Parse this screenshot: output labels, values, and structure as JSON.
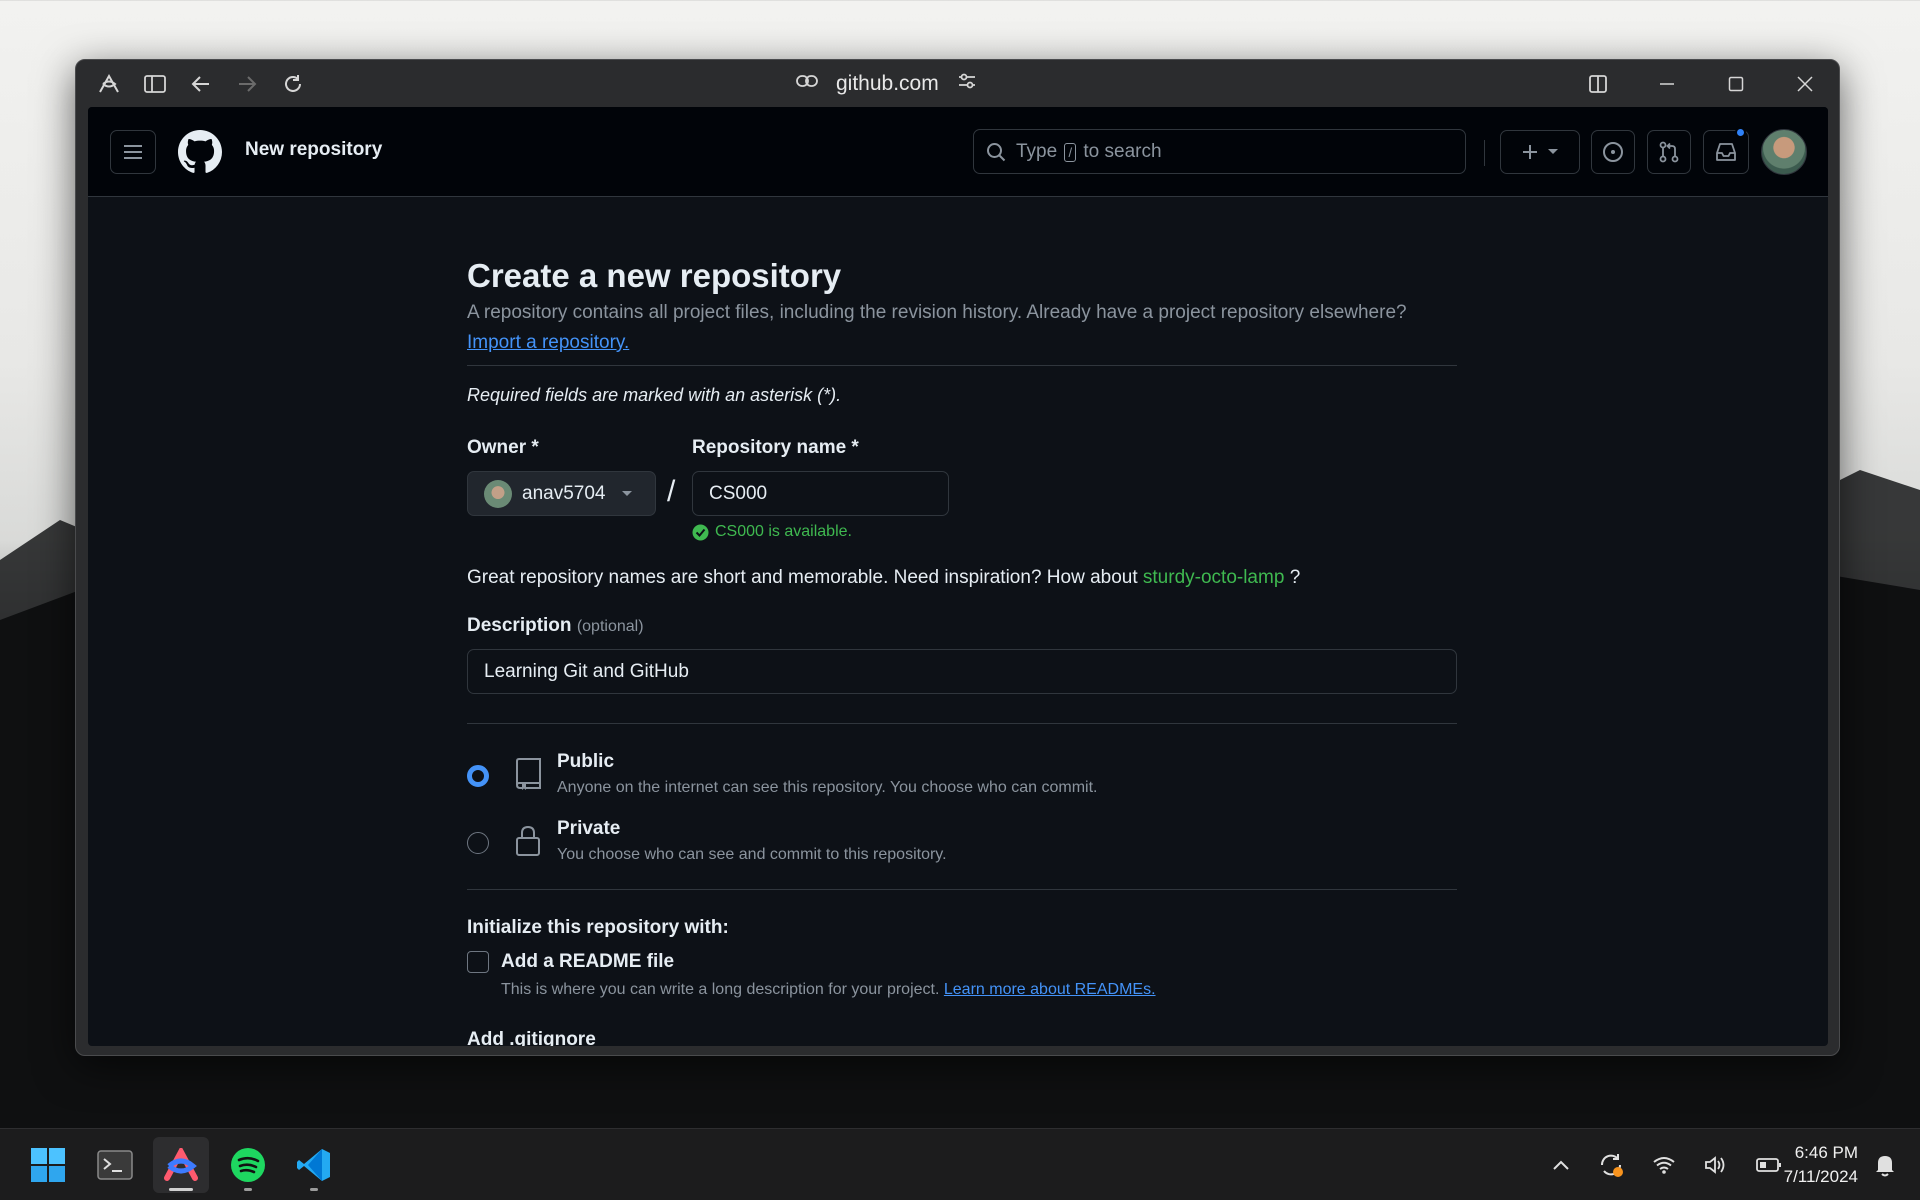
{
  "browser": {
    "url": "github.com"
  },
  "header": {
    "page_label": "New repository",
    "search_prefix": "Type",
    "search_key": "/",
    "search_suffix": "to search"
  },
  "form": {
    "title": "Create a new repository",
    "subtitle": "A repository contains all project files, including the revision history. Already have a project repository elsewhere?",
    "import_link": "Import a repository.",
    "required_note": "Required fields are marked with an asterisk (*).",
    "owner_label": "Owner *",
    "owner_value": "anav5704",
    "slash": "/",
    "repo_label": "Repository name *",
    "repo_value": "CS000",
    "availability": "CS000 is available.",
    "inspiration_prefix": "Great repository names are short and memorable. Need inspiration? How about",
    "inspiration_name": "sturdy-octo-lamp",
    "inspiration_suffix": "?",
    "description_label": "Description",
    "description_optional": "(optional)",
    "description_value": "Learning Git and GitHub",
    "visibility": [
      {
        "title": "Public",
        "desc": "Anyone on the internet can see this repository. You choose who can commit.",
        "checked": true
      },
      {
        "title": "Private",
        "desc": "You choose who can see and commit to this repository.",
        "checked": false
      }
    ],
    "init_label": "Initialize this repository with:",
    "readme_label": "Add a README file",
    "readme_desc": "This is where you can write a long description for your project.",
    "readme_link": "Learn more about READMEs.",
    "gitignore_label": "Add .gitignore"
  },
  "taskbar": {
    "time": "6:46 PM",
    "date": "7/11/2024"
  },
  "colors": {
    "accent_blue": "#4493f8",
    "success_green": "#3fb950",
    "gh_background": "#0d1117"
  }
}
